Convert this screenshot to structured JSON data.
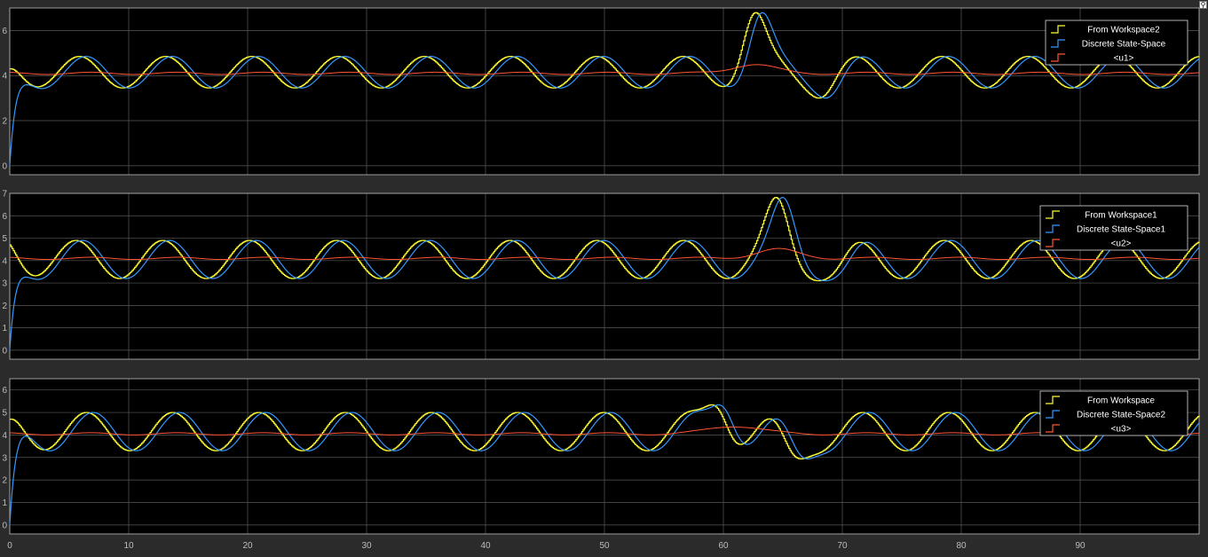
{
  "scope": {
    "background": "#000000",
    "grid_color": "#5a5a5a",
    "axes_color": "#bdbdbd",
    "pin_icon": "pin-icon"
  },
  "chart_data": [
    {
      "type": "line",
      "xlim": [
        0,
        100
      ],
      "ylim": [
        -0.4,
        7.0
      ],
      "yticks": [
        0,
        2,
        4,
        6
      ],
      "grid": true,
      "legend_position": "top-right",
      "series": [
        {
          "name": "From Workspace2",
          "color": "#ffff33",
          "role": "reference",
          "base": 4.15,
          "amp": 0.7,
          "period": 7.25,
          "phase": 4.0,
          "start": 0.0,
          "init": 4.3
        },
        {
          "name": "Discrete State-Space",
          "color": "#3399ff",
          "role": "output",
          "base": 4.15,
          "amp": 0.7,
          "period": 7.25,
          "phase": 4.6,
          "start": 0.0,
          "init": 0.0
        },
        {
          "name": "<u1>",
          "color": "#ff5533",
          "role": "control",
          "base": 4.1,
          "amp": 0.05,
          "period": 7.25,
          "phase": 5.0,
          "start": 0.0,
          "init": 4.1
        }
      ],
      "disturbance": {
        "center": 62.5,
        "width": 1.3,
        "height": 2.3,
        "after_center": 68.5,
        "after_depth": 0.6
      },
      "control_bump": {
        "center": 62.5,
        "width": 2.5,
        "height": 0.4
      }
    },
    {
      "type": "line",
      "xlim": [
        0,
        100
      ],
      "ylim": [
        -0.4,
        7.0
      ],
      "yticks": [
        0,
        1,
        2,
        3,
        4,
        5,
        6,
        7
      ],
      "grid": true,
      "legend_position": "top-right",
      "series": [
        {
          "name": "From Workspace1",
          "color": "#ffff33",
          "role": "reference",
          "base": 4.05,
          "amp": 0.85,
          "period": 7.3,
          "phase": 3.7,
          "start": 0.0,
          "init": 4.7
        },
        {
          "name": "Discrete State-Space1",
          "color": "#3399ff",
          "role": "output",
          "base": 4.05,
          "amp": 0.85,
          "period": 7.3,
          "phase": 4.3,
          "start": 0.0,
          "init": 0.0
        },
        {
          "name": "<u2>",
          "color": "#ff5533",
          "role": "control",
          "base": 4.1,
          "amp": 0.05,
          "period": 7.3,
          "phase": 5.0,
          "start": 0.0,
          "init": 4.0
        }
      ],
      "disturbance": {
        "center": 64.5,
        "width": 1.3,
        "height": 2.0,
        "after_center": 69.5,
        "after_depth": 0.5
      },
      "control_bump": {
        "center": 64.5,
        "width": 2.5,
        "height": 0.4
      }
    },
    {
      "type": "line",
      "xlim": [
        0,
        100
      ],
      "ylim": [
        -0.4,
        6.5
      ],
      "yticks": [
        0,
        1,
        2,
        3,
        4,
        5,
        6
      ],
      "grid": true,
      "legend_position": "top-right",
      "series": [
        {
          "name": "From Workspace",
          "color": "#ffff33",
          "role": "reference",
          "base": 4.15,
          "amp": 0.85,
          "period": 7.25,
          "phase": 4.6,
          "start": 0.0,
          "init": 4.7
        },
        {
          "name": "Discrete State-Space2",
          "color": "#3399ff",
          "role": "output",
          "base": 4.15,
          "amp": 0.85,
          "period": 7.25,
          "phase": 5.2,
          "start": 0.0,
          "init": 0.0
        },
        {
          "name": "<u3>",
          "color": "#ff5533",
          "role": "control",
          "base": 4.05,
          "amp": 0.05,
          "period": 7.25,
          "phase": 5.0,
          "start": 0.0,
          "init": 4.1
        }
      ],
      "disturbance": {
        "center": 59.5,
        "width": 1.3,
        "height": 1.4,
        "after_center": 65.8,
        "after_depth": 1.3
      },
      "control_bump": {
        "center": 61.0,
        "width": 3.0,
        "height": 0.35
      }
    }
  ],
  "x_axis": {
    "ticks": [
      0,
      10,
      20,
      30,
      40,
      50,
      60,
      70,
      80,
      90
    ]
  }
}
